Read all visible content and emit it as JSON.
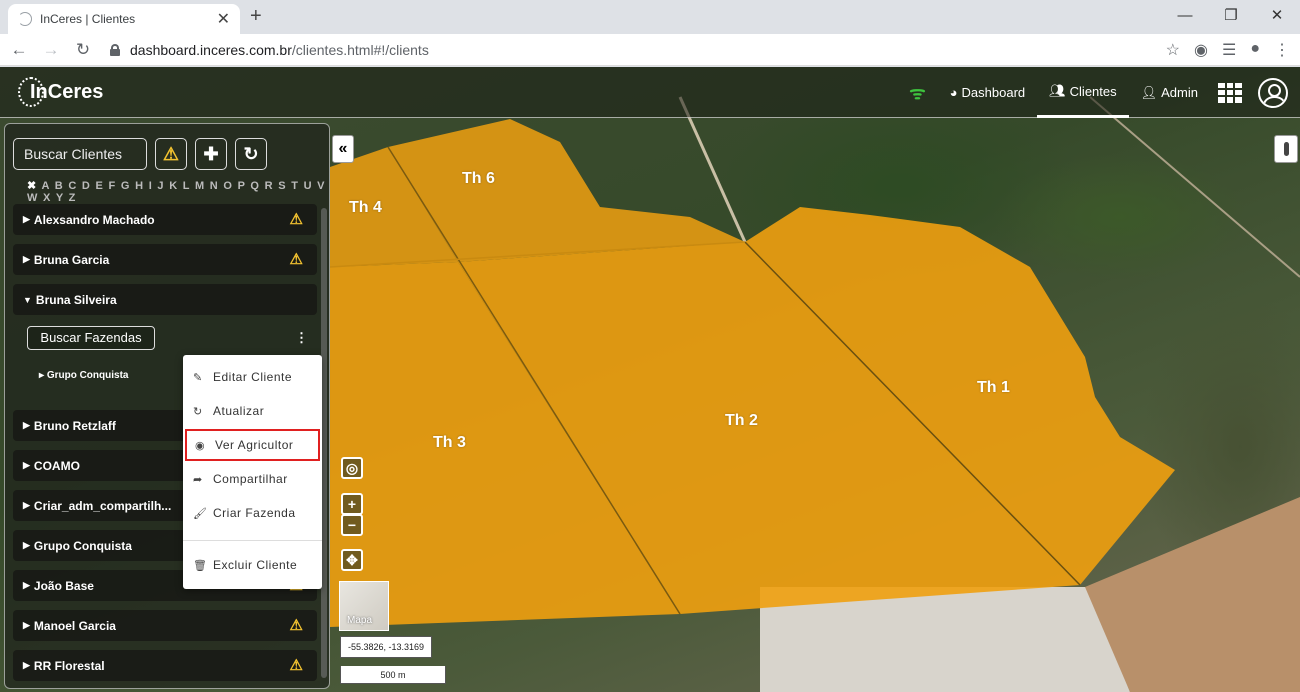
{
  "browser": {
    "tab_title": "InCeres | Clientes",
    "url_host": "dashboard.inceres.com.br",
    "url_path": "/clientes.html#!/clients"
  },
  "navbar": {
    "logo": "InCeres",
    "dashboard_label": "Dashboard",
    "clientes_label": "Clientes",
    "admin_label": "Admin"
  },
  "panel": {
    "search_placeholder": "Buscar Clientes",
    "alphabet": "A B C D E F G H I J K L M N O P Q R S T U V W X Y Z",
    "clients": [
      "Alexsandro Machado",
      "Bruna Garcia",
      "Bruna Silveira",
      "Bruno Retzlaff",
      "COAMO",
      "Criar_adm_compartilh...",
      "Grupo Conquista",
      "João Base",
      "Manoel Garcia",
      "RR Florestal"
    ],
    "farm_search_label": "Buscar Fazendas",
    "farm_item": "Grupo Conquista"
  },
  "context_menu": {
    "edit": "Editar Cliente",
    "refresh": "Atualizar",
    "view_farmer": "Ver Agricultor",
    "share": "Compartilhar",
    "create_farm": "Criar Fazenda",
    "delete": "Excluir Cliente"
  },
  "map": {
    "fields": [
      "Th 1",
      "Th 2",
      "Th 3",
      "Th 4",
      "Th 6"
    ],
    "basemap_label": "Mapa",
    "coordinates": "-55.3826, -13.3169",
    "scale": "500 m",
    "field_color": "#f0a010"
  }
}
